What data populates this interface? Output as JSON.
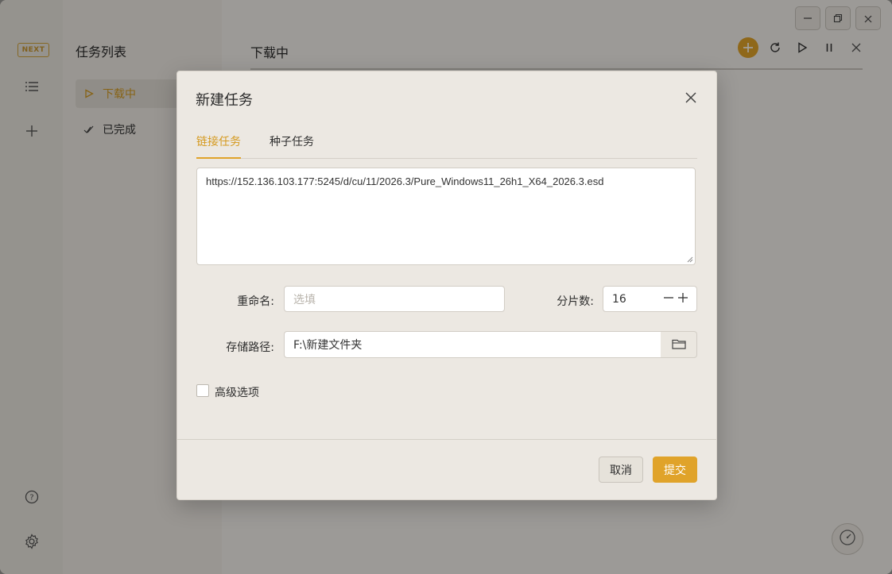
{
  "rail": {
    "logo": "NEXT",
    "icons": [
      "list-icon",
      "plus-icon",
      "help-icon",
      "gear-icon"
    ]
  },
  "task_list": {
    "title": "任务列表",
    "items": [
      {
        "label": "下载中",
        "icon": "play-icon",
        "active": true
      },
      {
        "label": "已完成",
        "icon": "double-check-icon",
        "active": false
      }
    ]
  },
  "main": {
    "title": "下载中",
    "toolbar": [
      "add-icon",
      "refresh-icon",
      "play-icon",
      "pause-icon",
      "close-icon"
    ]
  },
  "window_controls": [
    "minimize-icon",
    "restore-icon",
    "close-icon"
  ],
  "dialog": {
    "title": "新建任务",
    "tabs": [
      {
        "label": "链接任务",
        "active": true
      },
      {
        "label": "种子任务",
        "active": false
      }
    ],
    "url_value": "https://152.136.103.177:5245/d/cu/11/2026.3/Pure_Windows11_26h1_X64_2026.3.esd",
    "rename_label": "重命名:",
    "rename_placeholder": "选填",
    "chunks_label": "分片数:",
    "chunks_value": "16",
    "path_label": "存储路径:",
    "path_value": "F:\\新建文件夹",
    "advanced_label": "高级选项",
    "cancel_label": "取消",
    "submit_label": "提交"
  },
  "colors": {
    "accent": "#e0a32a",
    "active_text": "#d49b22"
  }
}
